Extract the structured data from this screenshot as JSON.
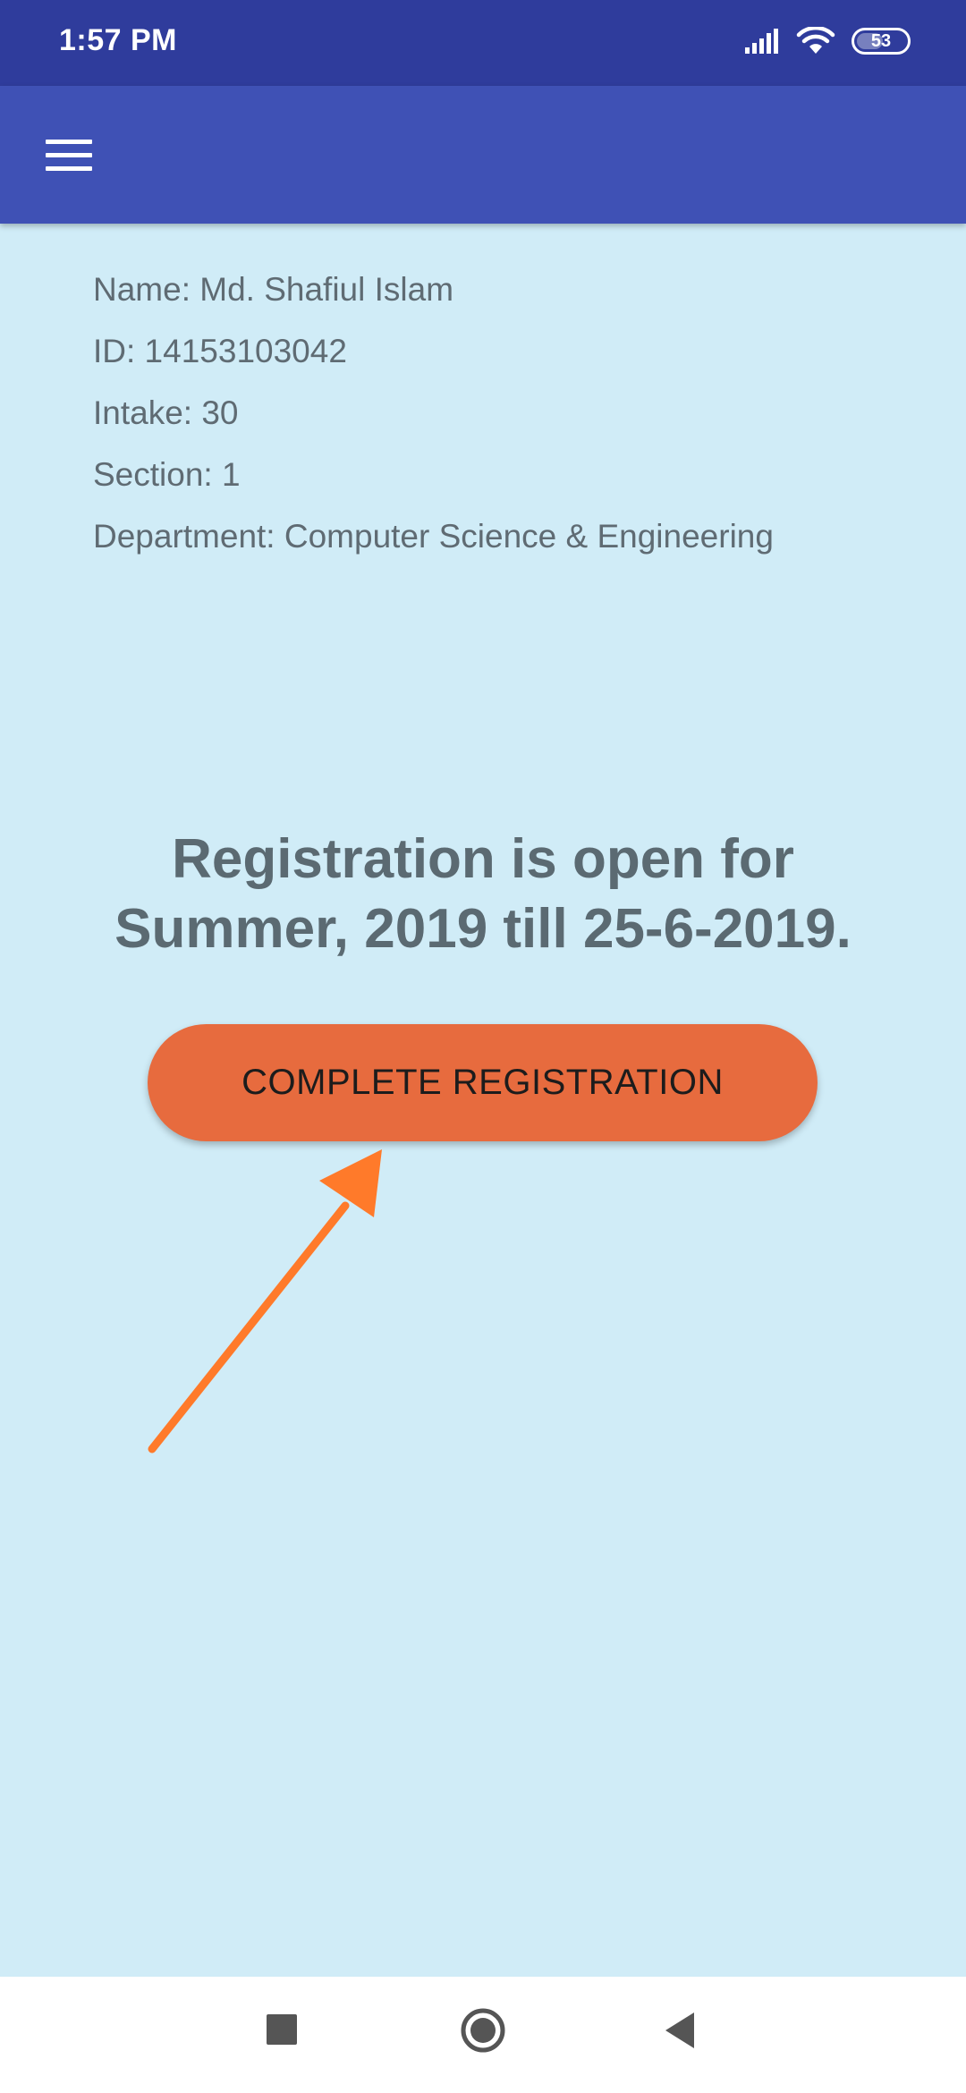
{
  "status_bar": {
    "time": "1:57 PM",
    "battery": "53",
    "icons": [
      "signal-icon",
      "wifi-icon",
      "battery-icon"
    ]
  },
  "app_bar": {
    "menu_icon": "menu-icon",
    "color": "#3f51b5"
  },
  "student": {
    "name": "Name: Md. Shafiul Islam",
    "id": "ID: 14153103042",
    "intake": "Intake: 30",
    "section": "Section: 1",
    "department": "Department: Computer Science & Engineering"
  },
  "registration": {
    "heading_line1": "Registration is open for",
    "heading_line2": "Summer, 2019 till 25-6-2019.",
    "button_label": "COMPLETE REGISTRATION",
    "button_color": "#e76b3e"
  },
  "annotation": {
    "arrow_icon": "arrow-icon",
    "color": "#ff7a2a"
  },
  "nav_bar": {
    "icons": [
      "recents-icon",
      "home-icon",
      "back-icon"
    ]
  }
}
